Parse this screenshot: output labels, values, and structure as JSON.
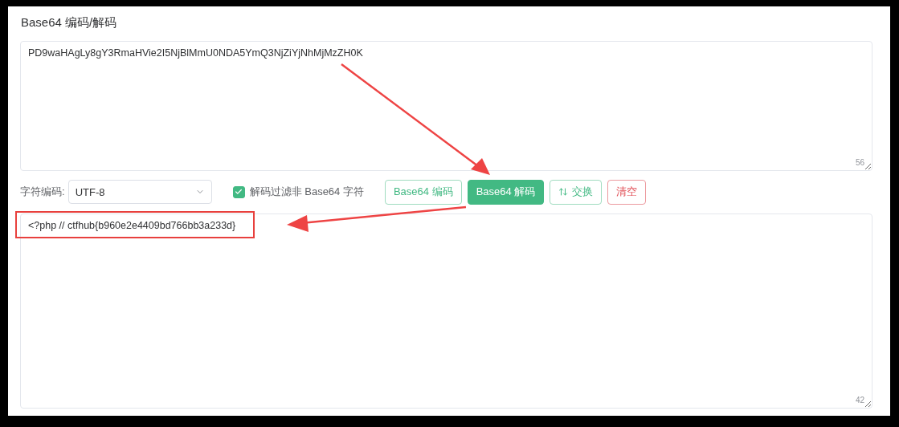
{
  "title": "Base64 编码/解码",
  "input": {
    "value": "PD9waHAgLy8gY3RmaHVie2I5NjBlMmU0NDA5YmQ3NjZiYjNhMjMzZH0K",
    "count": "56"
  },
  "encoding": {
    "label": "字符编码:",
    "value": "UTF-8"
  },
  "filter": {
    "label": "解码过滤非 Base64 字符",
    "checked": true
  },
  "buttons": [
    {
      "label": "Base64 编码",
      "kind": "outline"
    },
    {
      "label": "Base64 解码",
      "kind": "primary"
    },
    {
      "label": "交换",
      "kind": "swap"
    },
    {
      "label": "清空",
      "kind": "danger"
    }
  ],
  "output": {
    "value": "<?php // ctfhub{b960e2e4409bd766bb3a233d}",
    "count": "42"
  }
}
